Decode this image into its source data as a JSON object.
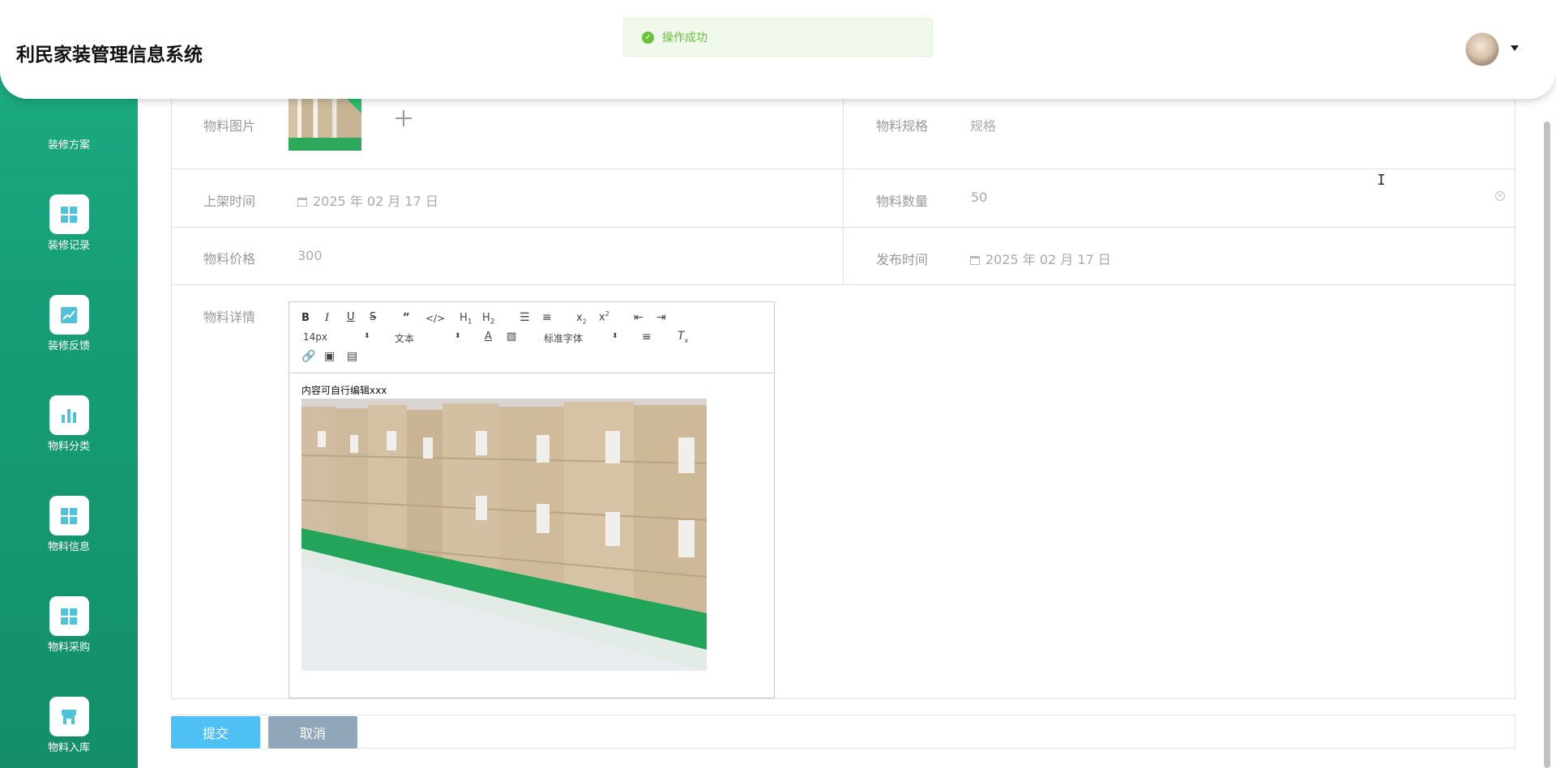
{
  "app": {
    "title": "利民家装管理信息系统"
  },
  "toast": {
    "message": "操作成功",
    "status_color": "#67c23a"
  },
  "sidebar": {
    "top_label": "装修方案",
    "items": [
      {
        "label": "装修记录",
        "icon": "grid-icon"
      },
      {
        "label": "装修反馈",
        "icon": "chart-line-icon"
      },
      {
        "label": "物料分类",
        "icon": "bar-chart-icon"
      },
      {
        "label": "物料信息",
        "icon": "grid-icon"
      },
      {
        "label": "物料采购",
        "icon": "grid-icon"
      },
      {
        "label": "物料入库",
        "icon": "store-icon"
      }
    ],
    "accent_color": "#1aa67c"
  },
  "form": {
    "image_label": "物料图片",
    "spec_label": "物料规格",
    "spec_value": "规格",
    "shelf_time_label": "上架时间",
    "shelf_time_value": "2025 年 02 月 17 日",
    "quantity_label": "物料数量",
    "quantity_value": "50",
    "price_label": "物料价格",
    "price_value": "300",
    "publish_time_label": "发布时间",
    "publish_time_value": "2025 年 02 月 17 日",
    "detail_label": "物料详情"
  },
  "editor": {
    "font_size": "14px",
    "header_select": "文本",
    "font_family": "标准字体",
    "content_text": "内容可自行编辑xxx",
    "buttons": [
      "bold",
      "italic",
      "underline",
      "strike",
      "blockquote",
      "code-block",
      "h1",
      "h2",
      "ordered-list",
      "bullet-list",
      "subscript",
      "superscript",
      "outdent",
      "indent",
      "color",
      "background",
      "align",
      "clean",
      "link",
      "image",
      "video"
    ]
  },
  "actions": {
    "submit": "提交",
    "cancel": "取消"
  },
  "colors": {
    "submit": "#4fc0f3",
    "cancel": "#8fa7b8"
  }
}
